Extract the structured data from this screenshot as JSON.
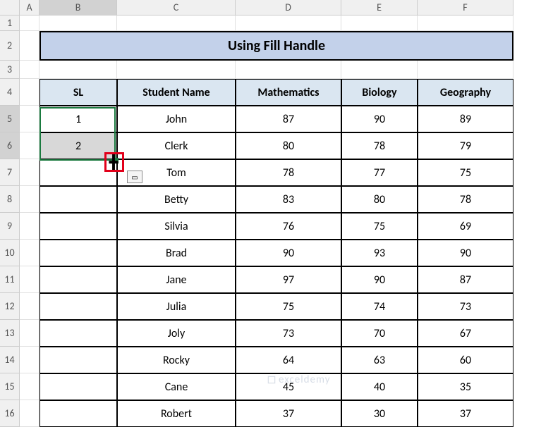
{
  "columns": [
    "A",
    "B",
    "C",
    "D",
    "E",
    "F"
  ],
  "rows": [
    "1",
    "2",
    "3",
    "4",
    "5",
    "6",
    "7",
    "8",
    "9",
    "10",
    "11",
    "12",
    "13",
    "14",
    "15",
    "16"
  ],
  "title": "Using Fill Handle",
  "headers": {
    "sl": "SL",
    "name": "Student Name",
    "math": "Mathematics",
    "bio": "Biology",
    "geo": "Geography"
  },
  "data": [
    {
      "sl": "1",
      "name": "John",
      "math": "87",
      "bio": "90",
      "geo": "89"
    },
    {
      "sl": "2",
      "name": "Clerk",
      "math": "80",
      "bio": "78",
      "geo": "79"
    },
    {
      "sl": "",
      "name": "Tom",
      "math": "78",
      "bio": "77",
      "geo": "75"
    },
    {
      "sl": "",
      "name": "Betty",
      "math": "83",
      "bio": "80",
      "geo": "78"
    },
    {
      "sl": "",
      "name": "Silvia",
      "math": "76",
      "bio": "75",
      "geo": "69"
    },
    {
      "sl": "",
      "name": "Brad",
      "math": "90",
      "bio": "93",
      "geo": "90"
    },
    {
      "sl": "",
      "name": "Jane",
      "math": "97",
      "bio": "90",
      "geo": "87"
    },
    {
      "sl": "",
      "name": "Julia",
      "math": "75",
      "bio": "74",
      "geo": "73"
    },
    {
      "sl": "",
      "name": "Joly",
      "math": "73",
      "bio": "70",
      "geo": "67"
    },
    {
      "sl": "",
      "name": "Rocky",
      "math": "64",
      "bio": "63",
      "geo": "60"
    },
    {
      "sl": "",
      "name": "Cane",
      "math": "45",
      "bio": "40",
      "geo": "35"
    },
    {
      "sl": "",
      "name": "Robert",
      "math": "37",
      "bio": "30",
      "geo": "37"
    }
  ],
  "watermark": "exceldemy",
  "chart_data": {
    "type": "table",
    "title": "Using Fill Handle",
    "columns": [
      "SL",
      "Student Name",
      "Mathematics",
      "Biology",
      "Geography"
    ],
    "rows": [
      [
        1,
        "John",
        87,
        90,
        89
      ],
      [
        2,
        "Clerk",
        80,
        78,
        79
      ],
      [
        null,
        "Tom",
        78,
        77,
        75
      ],
      [
        null,
        "Betty",
        83,
        80,
        78
      ],
      [
        null,
        "Silvia",
        76,
        75,
        69
      ],
      [
        null,
        "Brad",
        90,
        93,
        90
      ],
      [
        null,
        "Jane",
        97,
        90,
        87
      ],
      [
        null,
        "Julia",
        75,
        74,
        73
      ],
      [
        null,
        "Joly",
        73,
        70,
        67
      ],
      [
        null,
        "Rocky",
        64,
        63,
        60
      ],
      [
        null,
        "Cane",
        45,
        40,
        35
      ],
      [
        null,
        "Robert",
        37,
        30,
        37
      ]
    ]
  }
}
